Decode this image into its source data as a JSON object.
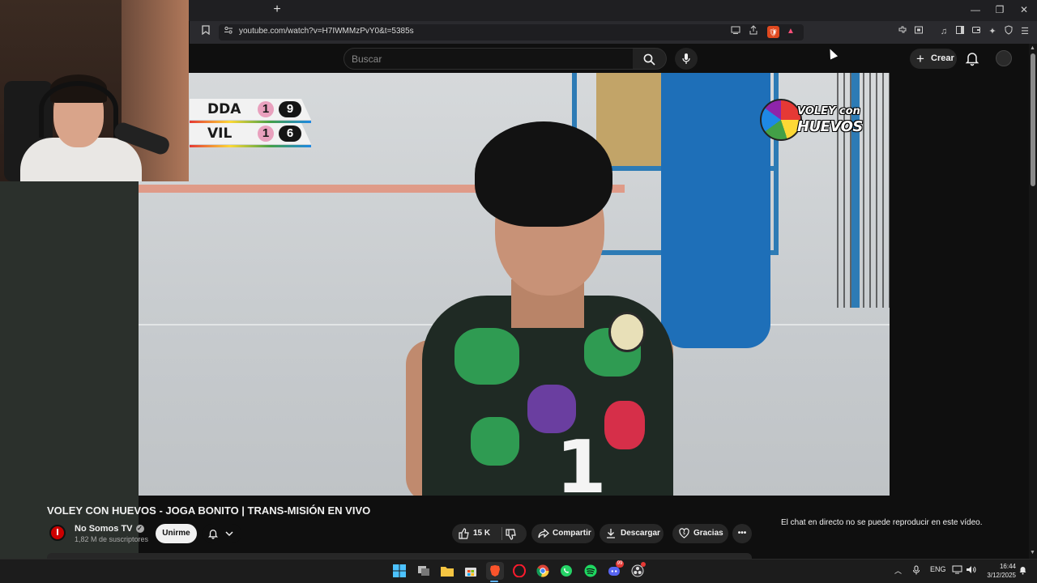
{
  "browser": {
    "url": "youtube.com/watch?v=H7IWMMzPvY0&t=5385s",
    "new_tab_symbol": "+",
    "window_controls": [
      "—",
      "❐",
      "✕"
    ]
  },
  "youtube_header": {
    "search_placeholder": "Buscar",
    "create_label": "Crear"
  },
  "video_overlay": {
    "scoreboard": [
      {
        "team": "DDA",
        "sets": "1",
        "points": "9"
      },
      {
        "team": "VIL",
        "sets": "1",
        "points": "6"
      }
    ],
    "logo_line1": "VOLEY con",
    "logo_line2": "HUEVOS",
    "jersey_number": "1"
  },
  "video_info": {
    "title": "VOLEY CON HUEVOS - JOGA BONITO | TRANS-MISIÓN EN VIVO",
    "channel_name": "No Somos TV",
    "subscribers": "1,82 M de suscriptores",
    "join_label": "Unirme",
    "likes": "15 K",
    "share_label": "Compartir",
    "download_label": "Descargar",
    "thanks_label": "Gracias",
    "more_label": "•••"
  },
  "chat": {
    "message": "El chat en directo no se puede reproducir en este vídeo."
  },
  "taskbar": {
    "language": "ENG",
    "time": "16:44",
    "date": "3/12/2025",
    "discord_badge": "99"
  },
  "colors": {
    "youtube_bg": "#0f0f0f",
    "pill_bg": "#272727",
    "court_pad_blue": "#1e6fb8",
    "channel_red": "#cc0000"
  }
}
